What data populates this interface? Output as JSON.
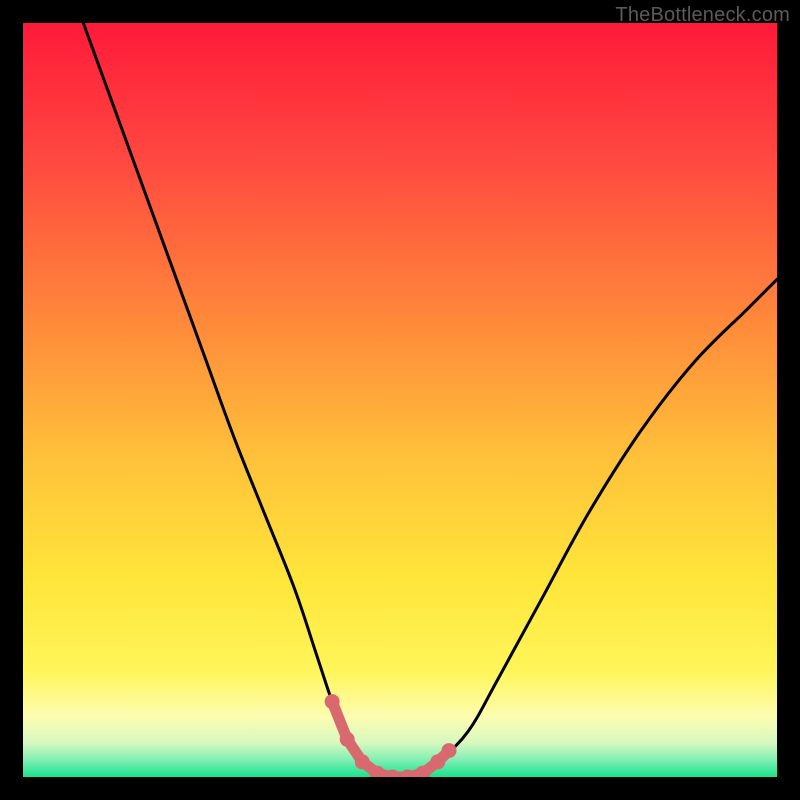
{
  "watermark": "TheBottleneck.com",
  "chart_data": {
    "type": "line",
    "title": "",
    "xlabel": "",
    "ylabel": "",
    "xlim": [
      0,
      100
    ],
    "ylim": [
      0,
      100
    ],
    "grid": false,
    "legend": false,
    "series": [
      {
        "name": "bottleneck-curve",
        "x": [
          8,
          12,
          16,
          20,
          24,
          28,
          32,
          36,
          39,
          41,
          43,
          45,
          47,
          49,
          51,
          53,
          55,
          59,
          63,
          69,
          75,
          82,
          89,
          96,
          100
        ],
        "y": [
          100,
          89,
          78,
          67,
          56,
          45,
          35,
          25,
          16,
          10,
          5,
          2,
          0.5,
          0,
          0,
          0.5,
          2,
          6,
          13,
          24,
          35,
          46,
          55,
          62,
          66
        ]
      },
      {
        "name": "curve-markers",
        "type": "scatter",
        "x": [
          41,
          43,
          45,
          47,
          49,
          51,
          53,
          55,
          56.5
        ],
        "y": [
          10,
          5,
          2,
          0.5,
          0,
          0,
          0.5,
          2,
          3.5
        ]
      }
    ],
    "background_gradient": {
      "stops": [
        {
          "offset": 0.0,
          "color": "#ff1a3a"
        },
        {
          "offset": 0.18,
          "color": "#ff4840"
        },
        {
          "offset": 0.4,
          "color": "#ff8a3a"
        },
        {
          "offset": 0.58,
          "color": "#ffc23a"
        },
        {
          "offset": 0.74,
          "color": "#ffe63a"
        },
        {
          "offset": 0.86,
          "color": "#fff55a"
        },
        {
          "offset": 0.92,
          "color": "#fdfdb0"
        },
        {
          "offset": 0.955,
          "color": "#d6f8c0"
        },
        {
          "offset": 0.975,
          "color": "#8bf0b5"
        },
        {
          "offset": 1.0,
          "color": "#18e38e"
        }
      ]
    },
    "curve_color": "#000000",
    "marker_color": "#d86a6f"
  }
}
